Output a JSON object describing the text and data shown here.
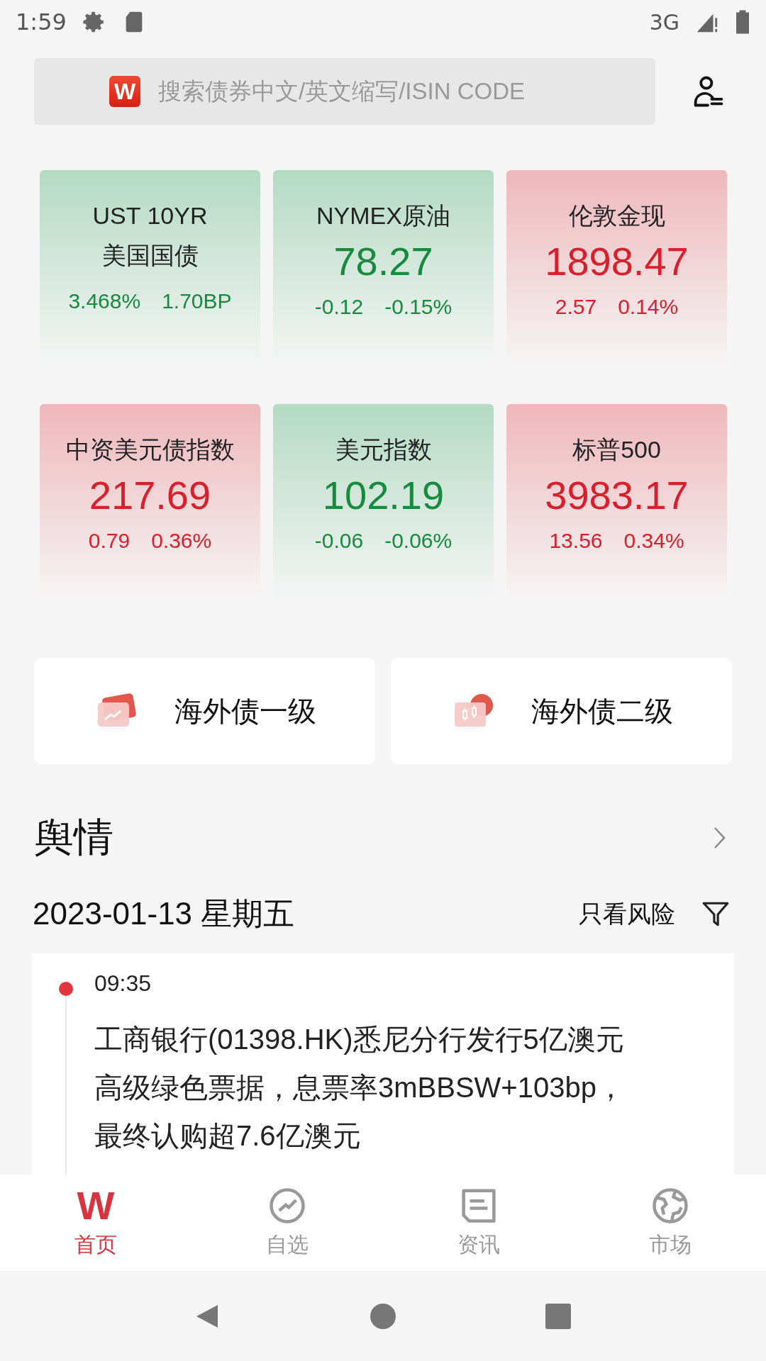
{
  "status_bar": {
    "time": "1:59",
    "network": "3G"
  },
  "search": {
    "logo": "W",
    "placeholder": "搜索债券中文/英文缩写/ISIN CODE"
  },
  "tickers": [
    {
      "title": [
        "UST 10YR",
        "美国国债"
      ],
      "change": "3.468%",
      "change_pct": "1.70BP",
      "kind": "down"
    },
    {
      "title": [
        "NYMEX原油"
      ],
      "value": "78.27",
      "change": "-0.12",
      "change_pct": "-0.15%",
      "kind": "down"
    },
    {
      "title": [
        "伦敦金现"
      ],
      "value": "1898.47",
      "change": "2.57",
      "change_pct": "0.14%",
      "kind": "up"
    },
    {
      "title": [
        "中资美元债指数"
      ],
      "value": "217.69",
      "change": "0.79",
      "change_pct": "0.36%",
      "kind": "up"
    },
    {
      "title": [
        "美元指数"
      ],
      "value": "102.19",
      "change": "-0.06",
      "change_pct": "-0.06%",
      "kind": "down"
    },
    {
      "title": [
        "标普500"
      ],
      "value": "3983.17",
      "change": "13.56",
      "change_pct": "0.34%",
      "kind": "up"
    }
  ],
  "shortcuts": [
    {
      "label": "海外债一级",
      "kind": "primary"
    },
    {
      "label": "海外债二级",
      "kind": "secondary"
    }
  ],
  "sentiment": {
    "title": "舆情",
    "date": "2023-01-13 星期五",
    "filter": "只看风险",
    "items": [
      {
        "time": "09:35",
        "text": "工商银行(01398.HK)悉尼分行发行5亿澳元高级绿色票据，息票率3mBBSW+103bp，最终认购超7.6亿澳元"
      }
    ]
  },
  "bottom_nav": [
    {
      "label": "首页",
      "kind": "logo",
      "icon_text": "W",
      "selected": true
    },
    {
      "label": "自选",
      "kind": "watchlist",
      "selected": false
    },
    {
      "label": "资讯",
      "kind": "news",
      "selected": false
    },
    {
      "label": "市场",
      "kind": "market",
      "selected": false
    }
  ]
}
